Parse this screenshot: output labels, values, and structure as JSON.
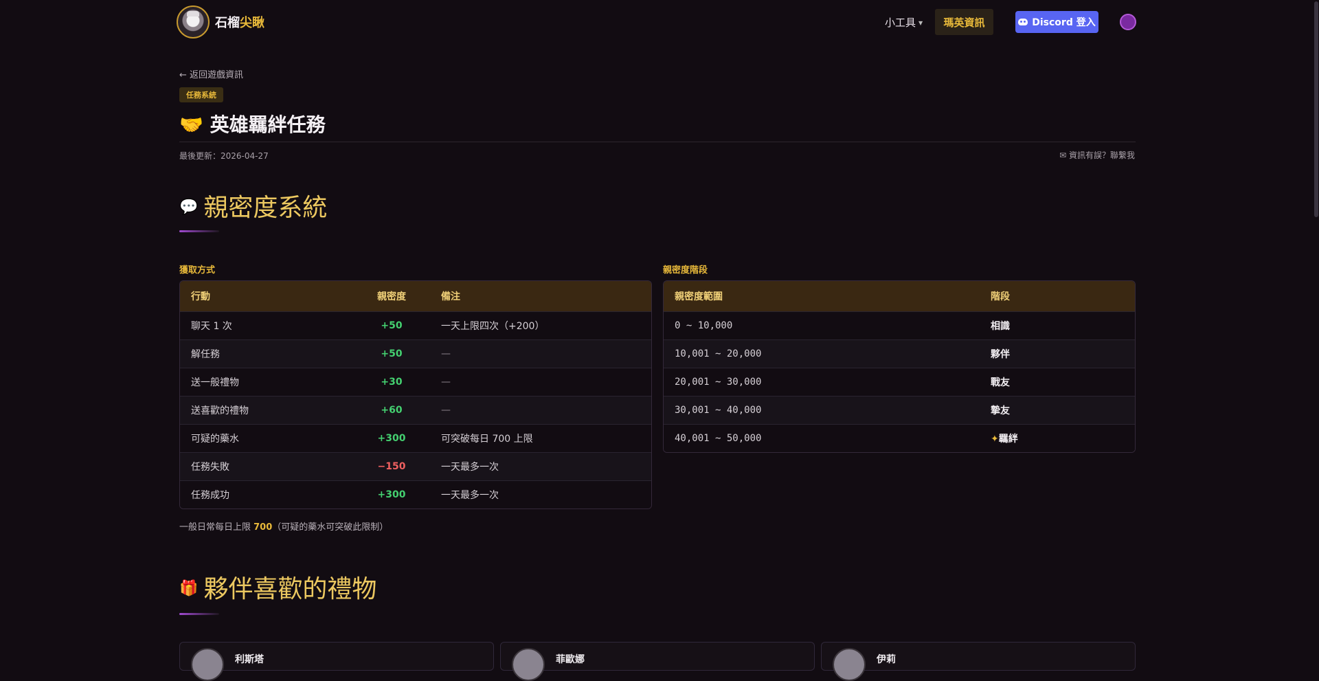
{
  "header": {
    "brand_main": "石榴",
    "brand_accent": "尖瞅",
    "tools_label": "小工具",
    "heroes_label": "瑪英資訊",
    "discord_label": "Discord 登入"
  },
  "page": {
    "back_label": "← 返回遊戲資訊",
    "tag": "任務系統",
    "title_emoji": "🤝",
    "title": "英雄羈絆任務",
    "updated": "最後更新：2026-04-27",
    "report": "✉ 資訊有誤？聯繫我"
  },
  "section1": {
    "emoji": "💬",
    "title": "親密度系統",
    "left_label": "獲取方式",
    "left_headers": [
      "行動",
      "親密度",
      "備注"
    ],
    "left_rows": [
      {
        "action": "聊天 1 次",
        "value": "+50",
        "note": "一天上限四次（+200）",
        "kind": "pos"
      },
      {
        "action": "解任務",
        "value": "+50",
        "note": "—",
        "kind": "pos"
      },
      {
        "action": "送一般禮物",
        "value": "+30",
        "note": "—",
        "kind": "pos"
      },
      {
        "action": "送喜歡的禮物",
        "value": "+60",
        "note": "—",
        "kind": "pos"
      },
      {
        "action": "可疑的藥水",
        "value": "+300",
        "note": "可突破每日 700 上限",
        "kind": "pos"
      },
      {
        "action": "任務失敗",
        "value": "−150",
        "note": "一天最多一次",
        "kind": "neg"
      },
      {
        "action": "任務成功",
        "value": "+300",
        "note": "一天最多一次",
        "kind": "pos"
      }
    ],
    "right_label": "親密度階段",
    "right_headers": [
      "親密度範圍",
      "階段"
    ],
    "right_rows": [
      {
        "range": "0 ~ 10,000",
        "stage": "相識"
      },
      {
        "range": "10,001 ~ 20,000",
        "stage": "夥伴"
      },
      {
        "range": "20,001 ~ 30,000",
        "stage": "戰友"
      },
      {
        "range": "30,001 ~ 40,000",
        "stage": "摯友"
      },
      {
        "range": "40,001 ~ 50,000",
        "stage": "羈絆",
        "star": "✦"
      }
    ],
    "note_prefix": "一般日常每日上限 ",
    "note_value": "700",
    "note_suffix": "（可疑的藥水可突破此限制）"
  },
  "section2": {
    "emoji": "🎁",
    "title": "夥伴喜歡的禮物",
    "cards": [
      {
        "name": "利斯塔"
      },
      {
        "name": "菲歐娜"
      },
      {
        "name": "伊莉"
      }
    ]
  }
}
